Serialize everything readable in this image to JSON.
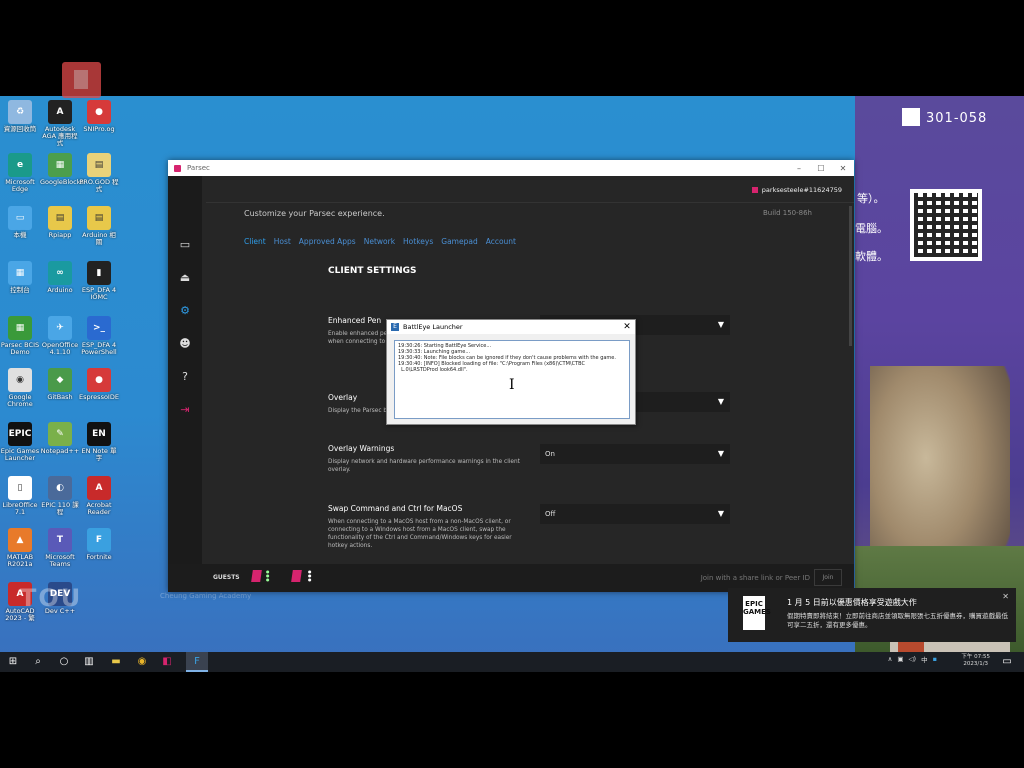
{
  "desktop": {
    "course_code": "301-058",
    "icons": [
      {
        "label": "資源回收筒",
        "color": "#8fb8e0",
        "glyph": "♻"
      },
      {
        "label": "Autodesk AGA 應用程式",
        "color": "#222222",
        "glyph": "A"
      },
      {
        "label": "SNIPro.og",
        "color": "#d63a3a",
        "glyph": "●"
      },
      {
        "label": "Microsoft Edge",
        "color": "#1a9a8a",
        "glyph": "e"
      },
      {
        "label": "GoogleBlocks",
        "color": "#4c9e4c",
        "glyph": "▦"
      },
      {
        "label": "PRO.GOD 程式",
        "color": "#e8d27a",
        "glyph": "▤"
      },
      {
        "label": "本機",
        "color": "#4aa6e6",
        "glyph": "▭"
      },
      {
        "label": "Rpiapp",
        "color": "#e8c84a",
        "glyph": "▤"
      },
      {
        "label": "Arduino 相關",
        "color": "#e8c84a",
        "glyph": "▤"
      },
      {
        "label": "控制台",
        "color": "#4aa6e6",
        "glyph": "▦"
      },
      {
        "label": "Arduino",
        "color": "#1a9aa0",
        "glyph": "∞"
      },
      {
        "label": "ESP_DFA 4 IOMC",
        "color": "#222222",
        "glyph": "▮"
      },
      {
        "label": "Parsec BCIS Demo",
        "color": "#3a9a3a",
        "glyph": "▦"
      },
      {
        "label": "OpenOffice 4.1.10",
        "color": "#4aa6e6",
        "glyph": "✈"
      },
      {
        "label": "ESP_DFA 4 PowerShell",
        "color": "#2a6ad0",
        "glyph": ">_"
      },
      {
        "label": "Google Chrome",
        "color": "#e0e0e0",
        "glyph": "◉"
      },
      {
        "label": "GitBash",
        "color": "#4a9a4a",
        "glyph": "◆"
      },
      {
        "label": "EspressoIDE",
        "color": "#d63a3a",
        "glyph": "●"
      },
      {
        "label": "Epic Games Launcher",
        "color": "#111111",
        "glyph": "EPIC"
      },
      {
        "label": "Notepad++",
        "color": "#7ab04a",
        "glyph": "✎"
      },
      {
        "label": "EN Note 單字",
        "color": "#111111",
        "glyph": "EN"
      },
      {
        "label": "LibreOffice 7.1",
        "color": "#ffffff",
        "glyph": "▯"
      },
      {
        "label": "EPIC 110 課程",
        "color": "#4a6a9a",
        "glyph": "◐"
      },
      {
        "label": "Acrobat Reader",
        "color": "#c82a2a",
        "glyph": "A"
      },
      {
        "label": "MATLAB R2021a",
        "color": "#e87a2a",
        "glyph": "▲"
      },
      {
        "label": "Microsoft Teams",
        "color": "#5a5ab8",
        "glyph": "T"
      },
      {
        "label": "Fortnite",
        "color": "#3aa0e0",
        "glyph": "F"
      },
      {
        "label": "AutoCAD 2023 - 繁",
        "color": "#c82a2a",
        "glyph": "A"
      },
      {
        "label": "Dev C++",
        "color": "#2a4a8a",
        "glyph": "DEV"
      }
    ],
    "side_text": [
      "等）。",
      "電腦。",
      "軟體。"
    ],
    "watermark": "TOU",
    "watermark_sub": "Cheung Gaming Academy"
  },
  "parsec": {
    "window_title": "Parsec",
    "username": "parksesteele#11624759",
    "subtitle": "Customize your Parsec experience.",
    "build": "Build 150-86h",
    "tabs": [
      {
        "label": "Client",
        "active": true
      },
      {
        "label": "Host",
        "active": false
      },
      {
        "label": "Approved Apps",
        "active": false
      },
      {
        "label": "Network",
        "active": false
      },
      {
        "label": "Hotkeys",
        "active": false
      },
      {
        "label": "Gamepad",
        "active": false
      },
      {
        "label": "Account",
        "active": false
      }
    ],
    "heading": "CLIENT SETTINGS",
    "settings": [
      {
        "title": "Enhanced Pen",
        "desc": "Enable enhanced pen support (pressure, rotation, and pressure) when connecting to Windows on the host.",
        "value": ""
      },
      {
        "title": "Overlay",
        "desc": "Display the Parsec button overlay.",
        "value": ""
      },
      {
        "title": "Overlay Warnings",
        "desc": "Display network and hardware performance warnings in the client overlay.",
        "value": "On"
      },
      {
        "title": "Swap Command and Ctrl for MacOS",
        "desc": "When connecting to a MacOS host from a non-MacOS client, or connecting to a Windows host from a MacOS client, swap the functionality of the Ctrl and Command/Windows keys for easier hotkey actions.",
        "value": "Off"
      }
    ],
    "guests_label": "GUESTS",
    "join_placeholder": "Join with a share link or Peer ID",
    "join_button": "Join"
  },
  "battleye": {
    "title": "BattlEye Launcher",
    "log": "19:30:26: Starting BattlEye Service...\n19:30:33: Launching game...\n19:30:40: Note: File blocks can be ignored if they don't cause problems with the game.\n19:30:40: [INFO] Blocked loading of file: \"C:\\Program Files (x86)\\CTM\\CTBC\n  L.0\\LRSTDProd look64.dll\"."
  },
  "toast": {
    "title": "1 月 5 日前以優惠價格享受遊戲大作",
    "body": "假期特賣即將結束！立即前往商店並領取無限張七五折優惠券，購買遊戲最低可享二五折，還有更多優惠。",
    "logo": "EPIC GAMES"
  },
  "taskbar": {
    "time": "下午 07:55",
    "date": "2023/1/3",
    "ime": "中"
  },
  "colors": {
    "parsec_accent": "#d6246e",
    "tab_blue": "#2f9eea",
    "desktop_blue": "#2a8fd0"
  }
}
